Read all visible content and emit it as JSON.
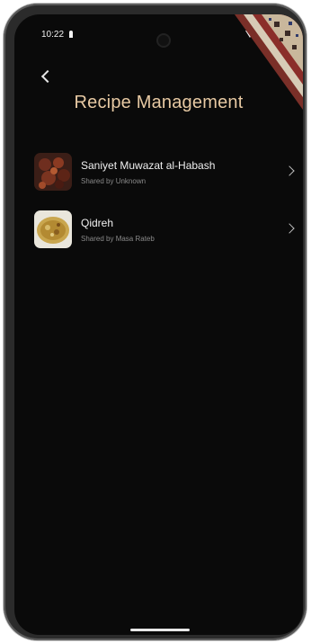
{
  "status": {
    "time": "10:22"
  },
  "header": {
    "back_label": "back",
    "title": "Recipe Management"
  },
  "recipes": [
    {
      "name": "Saniyet Muwazat al-Habash",
      "shared_by": "Shared by Unknown"
    },
    {
      "name": "Qidreh",
      "shared_by": "Shared by Masa Rateb"
    }
  ],
  "colors": {
    "accent": "#e7c9a3",
    "background": "#0a0a0a"
  },
  "icons": [
    "back-chevron-icon",
    "chevron-right-icon",
    "wifi-icon",
    "signal-icon",
    "battery-icon"
  ]
}
